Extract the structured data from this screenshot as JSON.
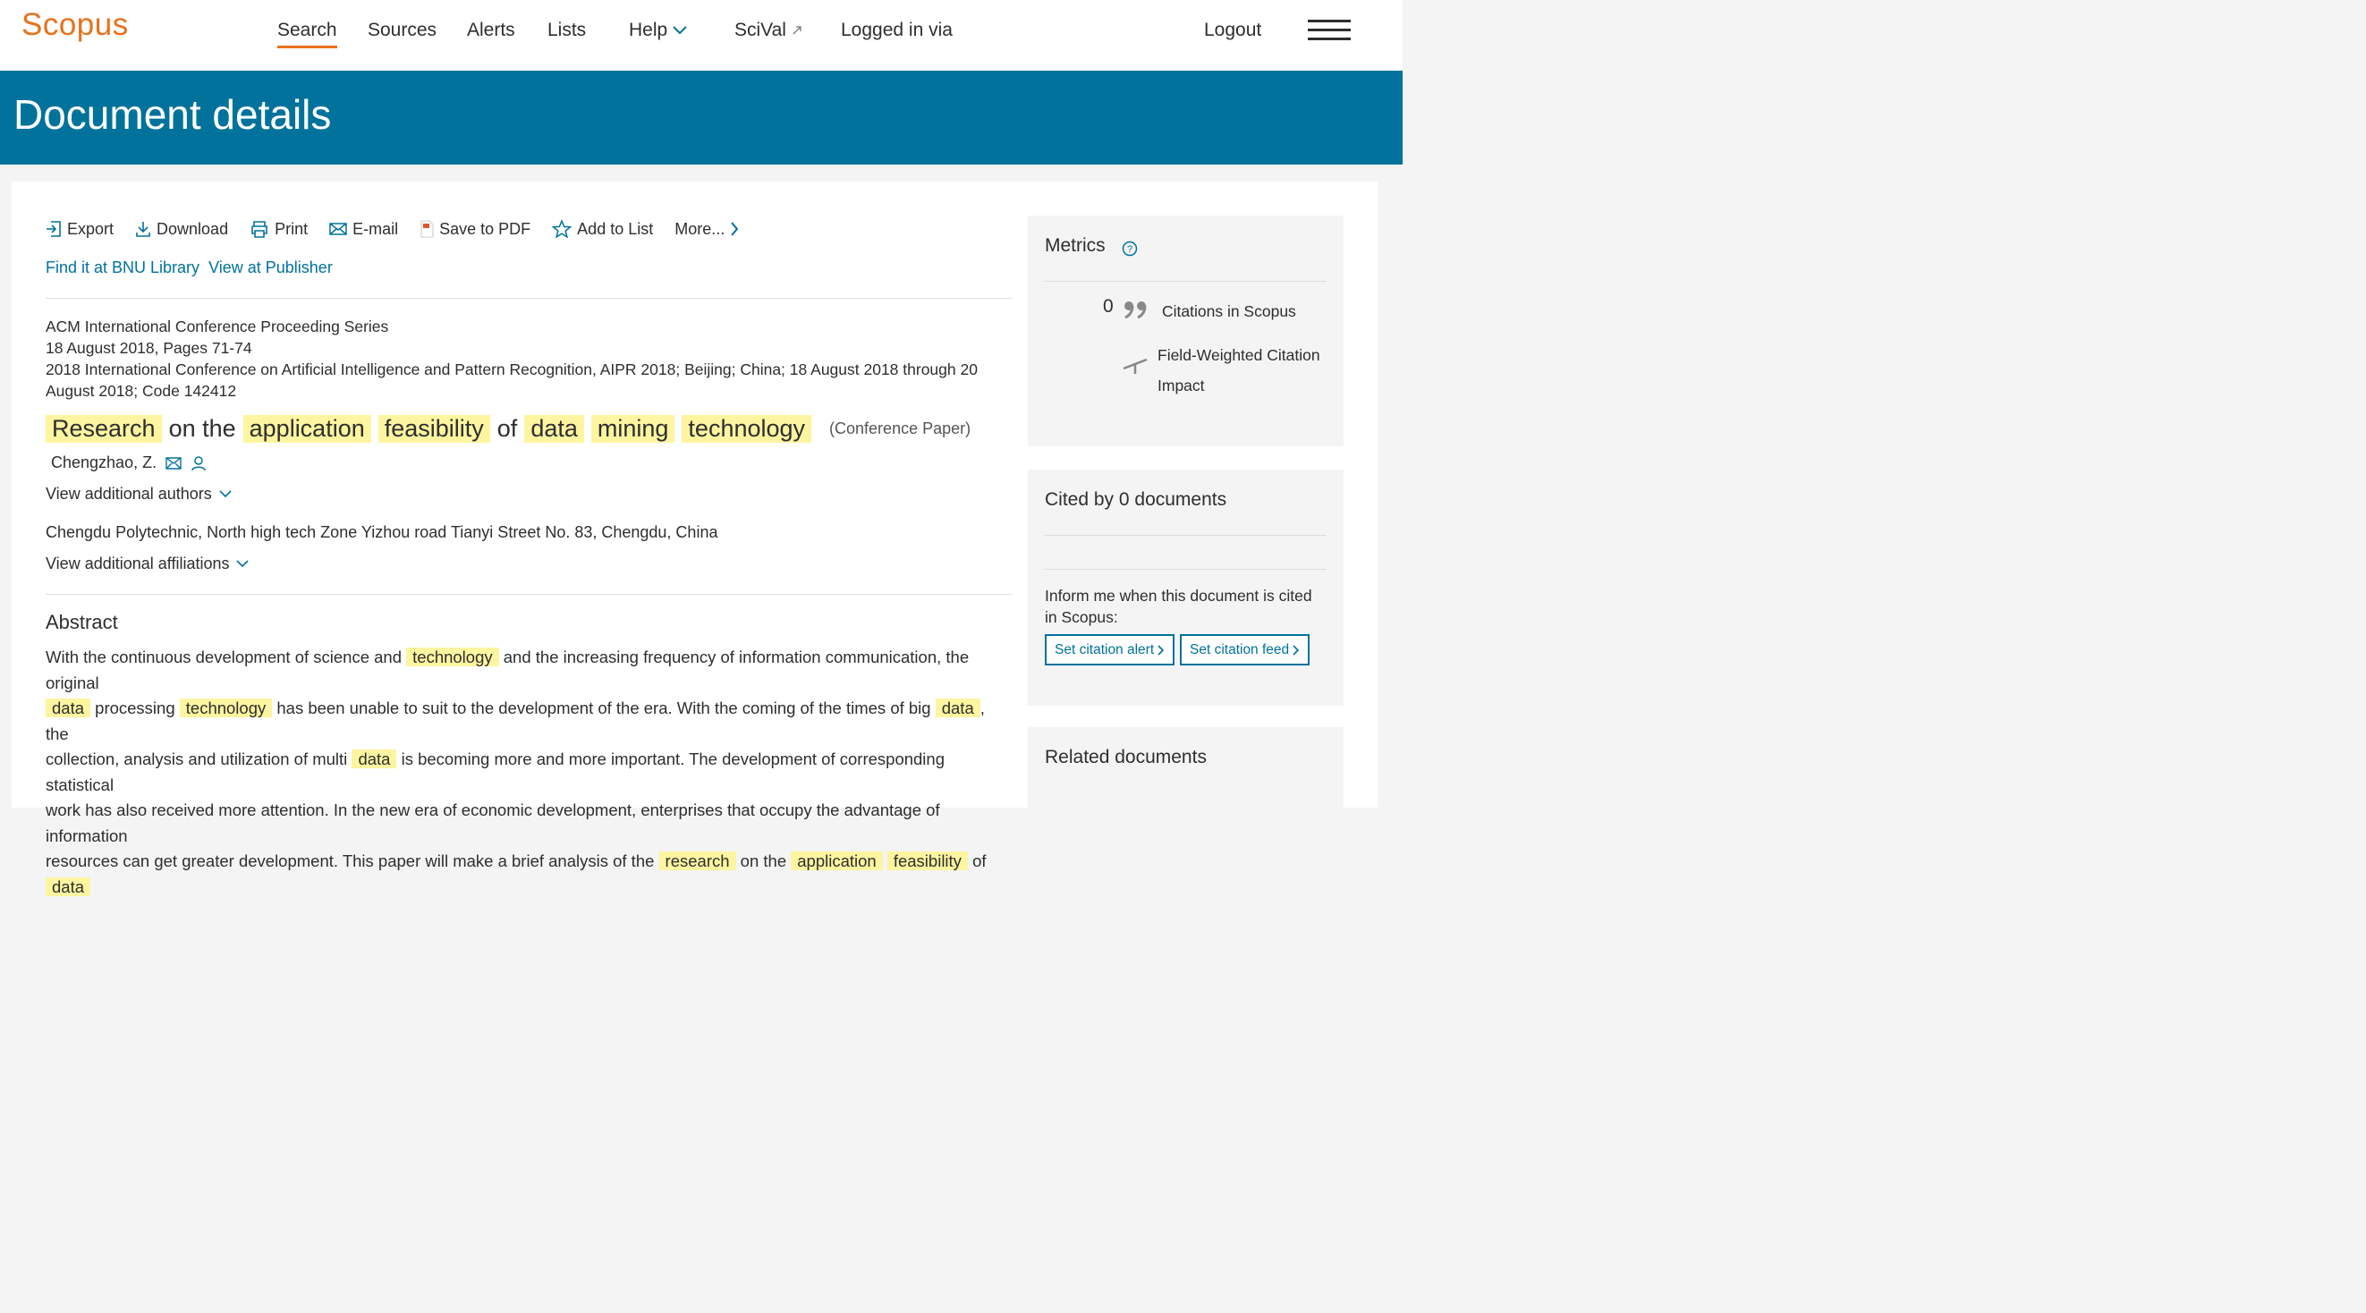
{
  "header": {
    "logo": "Scopus",
    "nav": {
      "search": "Search",
      "sources": "Sources",
      "alerts": "Alerts",
      "lists": "Lists",
      "help": "Help",
      "scival": "SciVal",
      "logged_in": "Logged in via",
      "logout": "Logout"
    },
    "accent_color": "#e9711c"
  },
  "banner": {
    "title": "Document details",
    "color": "#00729b"
  },
  "toolbar": {
    "export": "Export",
    "download": "Download",
    "print": "Print",
    "email": "E-mail",
    "save_pdf": "Save to PDF",
    "add_list": "Add to List",
    "more": "More..."
  },
  "links": {
    "find_library": "Find it at BNU Library",
    "view_publisher": "View at Publisher"
  },
  "source": {
    "series": "ACM International Conference Proceeding Series",
    "date_pages": "18 August 2018, Pages 71-74",
    "conference": "2018 International Conference on Artificial Intelligence and Pattern Recognition, AIPR 2018; Beijing; China; 18 August 2018 through 20 August 2018; Code 142412"
  },
  "title": {
    "words": [
      "Research",
      "on the",
      "application",
      "feasibility",
      "of",
      "data",
      "mining",
      "technology"
    ],
    "type": "(Conference Paper)"
  },
  "author": {
    "name": "Chengzhao, Z.",
    "view_more": "View additional authors"
  },
  "affiliation": {
    "text": "Chengdu Polytechnic, North high tech Zone Yizhou road Tianyi Street No. 83, Chengdu, China",
    "view_more": "View additional affiliations"
  },
  "abstract": {
    "heading": "Abstract",
    "l1a": "With the continuous development of science and",
    "l1b": "technology",
    "l1c": "and the increasing frequency of information communication, the original",
    "l2a": "data",
    "l2b": "processing",
    "l2c": "technology",
    "l2d": "has been unable to suit to the development of the era. With the coming of the times of big",
    "l2e": "data",
    "l2f": ", the",
    "l3a": "collection, analysis and utilization of multi",
    "l3b": "data",
    "l3c": "is becoming more and more important. The development of corresponding statistical",
    "l4": "work has also received more attention. In the new era of economic development, enterprises that occupy the advantage of information",
    "l5a": "resources can get greater development. This paper will make a brief analysis of the",
    "l5b": "research",
    "l5c": "on the",
    "l5d": "application",
    "l5e": "feasibility",
    "l5f": "of",
    "l5g": "data"
  },
  "metrics": {
    "title": "Metrics",
    "citations_count": "0",
    "citations_label": "Citations in Scopus",
    "fwci_label_1": "Field-Weighted Citation",
    "fwci_label_2": "Impact"
  },
  "cited_by": {
    "title": "Cited by 0 documents",
    "inform_1": "Inform me when this document is cited",
    "inform_2": "in Scopus:",
    "alert_btn": "Set citation alert",
    "feed_btn": "Set citation feed"
  },
  "related": {
    "title": "Related documents"
  },
  "highlight_color": "#fdf5a0"
}
